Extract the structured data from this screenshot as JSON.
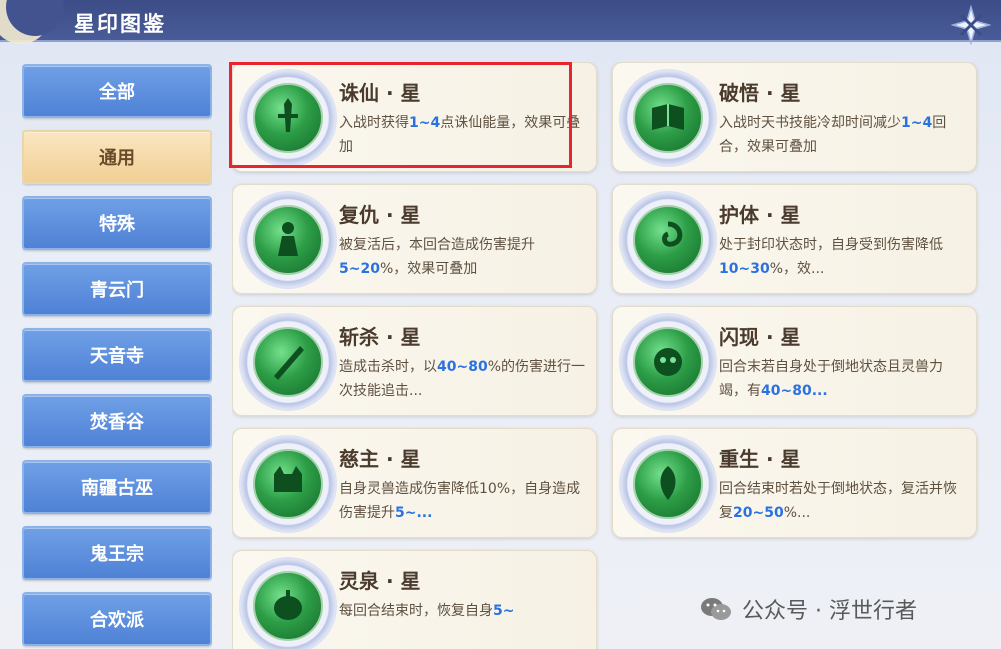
{
  "header": {
    "title": "星印图鉴"
  },
  "sidebar": {
    "items": [
      {
        "label": "全部",
        "active": false
      },
      {
        "label": "通用",
        "active": true
      },
      {
        "label": "特殊",
        "active": false
      },
      {
        "label": "青云门",
        "active": false
      },
      {
        "label": "天音寺",
        "active": false
      },
      {
        "label": "焚香谷",
        "active": false
      },
      {
        "label": "南疆古巫",
        "active": false
      },
      {
        "label": "鬼王宗",
        "active": false
      },
      {
        "label": "合欢派",
        "active": false
      }
    ]
  },
  "cards": [
    {
      "name": "诛仙 · 星",
      "icon": "sword-emblem-icon",
      "desc_parts": [
        [
          "入战时获得",
          false
        ],
        [
          "1~4",
          true
        ],
        [
          "点诛仙能量",
          false
        ],
        [
          "，效果可叠加",
          false
        ]
      ]
    },
    {
      "name": "破悟 · 星",
      "icon": "book-emblem-icon",
      "desc_parts": [
        [
          "入战时天书技能冷却时间减少",
          false
        ],
        [
          "1~4",
          true
        ],
        [
          "回合，效果可叠加",
          false
        ]
      ]
    },
    {
      "name": "复仇 · 星",
      "icon": "figure-emblem-icon",
      "desc_parts": [
        [
          "被复活后，本回合造成伤害提升",
          false
        ],
        [
          "5~20",
          true
        ],
        [
          "%，效果可叠加",
          false
        ]
      ]
    },
    {
      "name": "护体 · 星",
      "icon": "swirl-emblem-icon",
      "desc_parts": [
        [
          "处于封印状态时，自身受到伤害降低",
          false
        ],
        [
          "10~30",
          true
        ],
        [
          "%，效...",
          false
        ]
      ]
    },
    {
      "name": "斩杀 · 星",
      "icon": "slash-emblem-icon",
      "desc_parts": [
        [
          "造成击杀时，以",
          false
        ],
        [
          "40~80",
          true
        ],
        [
          "%的伤害进行一次技能追击...",
          false
        ]
      ]
    },
    {
      "name": "闪现 · 星",
      "icon": "beast-emblem-icon",
      "desc_parts": [
        [
          "回合末若自身处于倒地状态且灵兽力竭，有",
          false
        ],
        [
          "40~80...",
          true
        ]
      ]
    },
    {
      "name": "慈主 · 星",
      "icon": "cat-emblem-icon",
      "desc_parts": [
        [
          "自身灵兽造成伤害降低10%，自身造成伤害提升",
          false
        ],
        [
          "5~...",
          true
        ]
      ]
    },
    {
      "name": "重生 · 星",
      "icon": "phoenix-emblem-icon",
      "desc_parts": [
        [
          "回合结束时若处于倒地状态，复活并恢复",
          false
        ],
        [
          "20~50",
          true
        ],
        [
          "%...",
          false
        ]
      ]
    },
    {
      "name": "灵泉 · 星",
      "icon": "spring-emblem-icon",
      "desc_parts": [
        [
          "每回合结束时，恢复自身",
          false
        ],
        [
          "5~",
          true
        ]
      ]
    }
  ],
  "watermark": {
    "text": "公众号 · 浮世行者"
  },
  "colors": {
    "highlight": "#2a72e0",
    "selection_box": "#e8242e",
    "header": "#3b4c86"
  }
}
